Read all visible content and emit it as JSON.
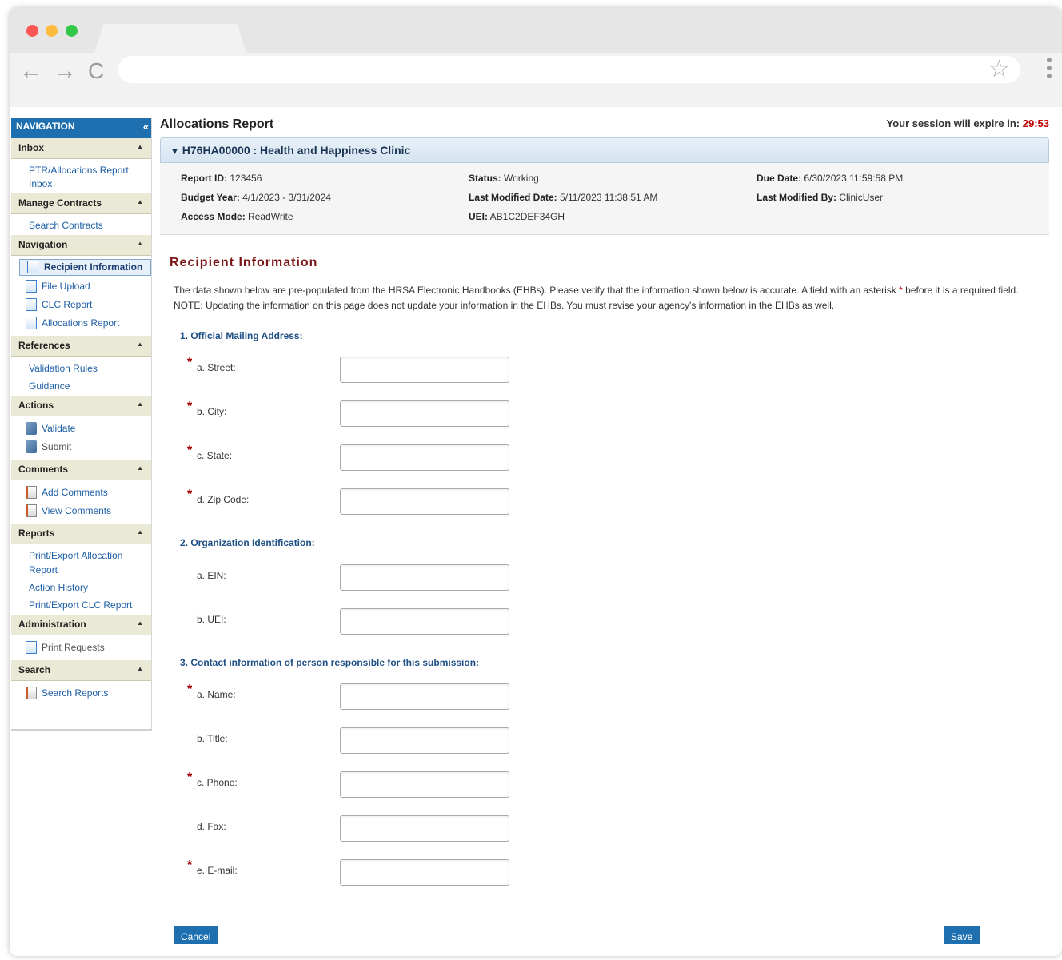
{
  "browser": {
    "back_icon": "←",
    "forward_icon": "→",
    "reload_icon": "C",
    "star_icon": "☆"
  },
  "sidebar": {
    "header": "NAVIGATION",
    "collapse_icon": "«",
    "sections": {
      "inbox": {
        "title": "Inbox",
        "items": [
          "PTR/Allocations Report",
          "Inbox"
        ]
      },
      "contracts": {
        "title": "Manage Contracts",
        "items": [
          "Search Contracts"
        ]
      },
      "navigation": {
        "title": "Navigation",
        "items": [
          "Recipient Information",
          "File Upload",
          "CLC Report",
          "Allocations Report"
        ]
      },
      "references": {
        "title": "References",
        "items": [
          "Validation Rules",
          "Guidance"
        ]
      },
      "actions": {
        "title": "Actions",
        "items": [
          "Validate",
          "Submit"
        ]
      },
      "comments": {
        "title": "Comments",
        "items": [
          "Add Comments",
          "View Comments"
        ]
      },
      "reports": {
        "title": "Reports",
        "items": [
          "Print/Export Allocation",
          "Report",
          "Action History",
          "Print/Export CLC Report"
        ]
      },
      "administration": {
        "title": "Administration",
        "items": [
          "Print Requests"
        ]
      },
      "search": {
        "title": "Search",
        "items": [
          "Search Reports"
        ]
      }
    }
  },
  "header": {
    "title": "Allocations Report",
    "session_label": "Your session will expire in:",
    "session_time": "29:53"
  },
  "clinic": {
    "title": "H76HA00000 : Health and Happiness Clinic"
  },
  "details": {
    "report_id_label": "Report ID:",
    "report_id": "123456",
    "budget_year_label": "Budget Year:",
    "budget_year": "4/1/2023 - 3/31/2024",
    "access_mode_label": "Access Mode:",
    "access_mode": "ReadWrite",
    "status_label": "Status:",
    "status": "Working",
    "last_modified_date_label": "Last Modified Date:",
    "last_modified_date": "5/11/2023 11:38:51 AM",
    "uei_label": "UEI:",
    "uei": "AB1C2DEF34GH",
    "due_date_label": "Due Date:",
    "due_date": "6/30/2023 11:59:58 PM",
    "last_modified_by_label": "Last Modified By:",
    "last_modified_by": "ClinicUser"
  },
  "form": {
    "heading": "Recipient Information",
    "intro_part1": "The data shown below are pre-populated from the HRSA Electronic Handbooks (EHBs). Please verify that the information shown below is accurate. A field with an asterisk",
    "intro_part2": "before it is a required field. NOTE: Updating the information on this page does not update your information in the EHBs. You must revise your agency's information in the EHBs as well.",
    "asterisk": "*",
    "section1": "1. Official Mailing Address:",
    "street": "a. Street:",
    "city": "b. City:",
    "state": "c. State:",
    "zip": "d. Zip Code:",
    "section2": "2. Organization Identification:",
    "ein": "a. EIN:",
    "uei": "b. UEI:",
    "section3": "3. Contact information of person responsible for this submission:",
    "name": "a. Name:",
    "title": "b. Title:",
    "phone": "c. Phone:",
    "fax": "d. Fax:",
    "email": "e. E-mail:",
    "cancel": "Cancel",
    "save": "Save"
  }
}
